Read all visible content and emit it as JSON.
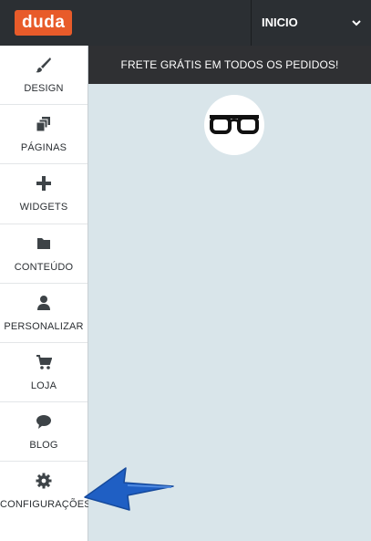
{
  "topbar": {
    "logo_text": "duda",
    "page_select": {
      "value": "INICIO",
      "icon": "chevron-down-icon"
    }
  },
  "sidebar": {
    "items": [
      {
        "label": "DESIGN",
        "icon": "brush-icon"
      },
      {
        "label": "PÁGINAS",
        "icon": "pages-icon"
      },
      {
        "label": "WIDGETS",
        "icon": "plus-icon"
      },
      {
        "label": "CONTEÚDO",
        "icon": "folder-icon"
      },
      {
        "label": "PERSONALIZAR",
        "icon": "user-icon"
      },
      {
        "label": "LOJA",
        "icon": "cart-icon"
      },
      {
        "label": "BLOG",
        "icon": "speech-bubble-icon"
      },
      {
        "label": "CONFIGURAÇÕES",
        "icon": "gear-icon"
      }
    ]
  },
  "preview": {
    "banner_text": "FRETE GRÁTIS EM TODOS OS PEDIDOS!",
    "logo_icon": "glasses-icon"
  },
  "colors": {
    "topbar": "#2b2f33",
    "brand": "#e85b2a",
    "preview_bg": "#d9e5ea",
    "banner": "#2f3033",
    "arrow": "#1f5fc4"
  }
}
